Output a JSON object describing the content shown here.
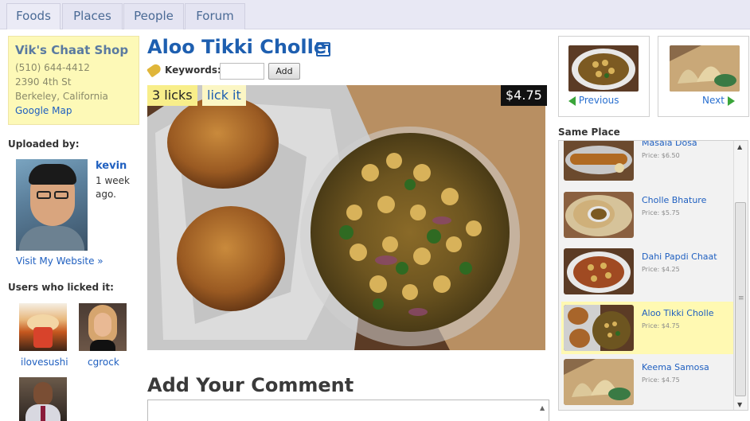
{
  "nav": {
    "tabs": [
      "Foods",
      "Places",
      "People",
      "Forum"
    ],
    "active_index": 0
  },
  "shop": {
    "name": "Vik's Chaat Shop",
    "phone": "(510) 644-4412",
    "street": "2390 4th St",
    "city": "Berkeley, California",
    "map_link": "Google Map"
  },
  "uploader": {
    "label": "Uploaded by:",
    "name": "kevin",
    "time": "1 week ago.",
    "website_link": "Visit My Website »"
  },
  "lickers": {
    "label": "Users who licked it:",
    "users": [
      {
        "name": "ilovesushi"
      },
      {
        "name": "cgrock"
      },
      {
        "name": ""
      }
    ]
  },
  "item": {
    "title": "Aloo Tikki Cholle",
    "keywords_label": "Keywords:",
    "keywords_value": "",
    "add_button": "Add",
    "licks": "3 licks",
    "lick_button": "lick it",
    "price": "$4.75"
  },
  "comment": {
    "heading": "Add Your Comment",
    "value": ""
  },
  "pager": {
    "previous": "Previous",
    "next": "Next"
  },
  "same_place": {
    "label": "Same Place",
    "items": [
      {
        "name": "Masala Dosa",
        "price": "Price: $6.50",
        "selected": false
      },
      {
        "name": "Cholle Bhature",
        "price": "Price: $5.75",
        "selected": false
      },
      {
        "name": "Dahi Papdi Chaat",
        "price": "Price: $4.25",
        "selected": false
      },
      {
        "name": "Aloo Tikki Cholle",
        "price": "Price: $4.75",
        "selected": true
      },
      {
        "name": "Keema Samosa",
        "price": "Price: $4.75",
        "selected": false
      }
    ]
  },
  "icons": {
    "tag": "tag-icon",
    "external_link": "external-link-icon",
    "arrow_left": "arrow-left-icon",
    "arrow_right": "arrow-right-icon"
  },
  "colors": {
    "link": "#2060c0",
    "title": "#1e5fb0",
    "shop_box": "#fdf9b7",
    "selected_row": "#fff9b2",
    "price_badge": "#111111",
    "arrow_green": "#3aa53a"
  }
}
